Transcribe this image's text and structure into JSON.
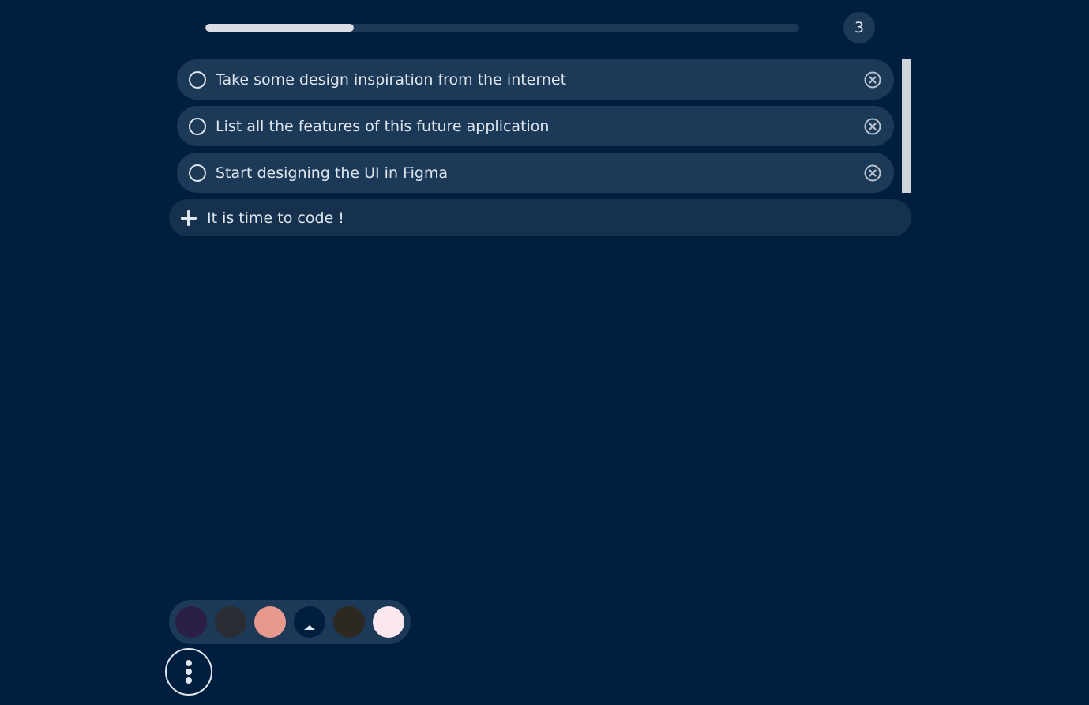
{
  "progress": {
    "fraction": 0.25
  },
  "task_count": "3",
  "tasks": [
    {
      "label": "Take some design inspiration from the internet",
      "done": false
    },
    {
      "label": "List all the features of this future application",
      "done": false
    },
    {
      "label": "Start designing the UI in Figma",
      "done": false
    }
  ],
  "add_task": {
    "placeholder": "It is time to code !"
  },
  "icons": {
    "checkbox": "empty-circle-icon",
    "remove": "circle-x-icon",
    "add": "plus-icon",
    "menu": "vertical-dots-icon"
  },
  "theme": {
    "background": "#001f3f",
    "surface": "#1c3a57",
    "text": "#dfe6ee",
    "progress_fill": "#d7dde3"
  },
  "palette": {
    "selected_index": 3,
    "colors": [
      "#2b1f45",
      "#2a2d34",
      "#e8998d",
      "#001f3f",
      "#2e2822",
      "#fbe7ee"
    ]
  }
}
